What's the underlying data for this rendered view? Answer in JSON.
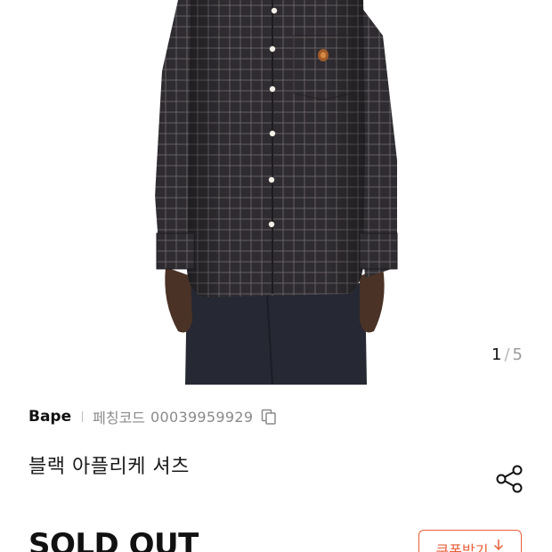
{
  "gallery": {
    "current": "1",
    "separator": "/",
    "total": "5"
  },
  "product": {
    "brand": "Bape",
    "code_label": "페칭코드",
    "code_value": "00039959929",
    "title": "블랙 아플리케 셔츠",
    "status": "SOLD OUT"
  },
  "actions": {
    "coupon_label": "쿠폰받기",
    "coupon_icon": "download-arrow-icon",
    "share_icon": "share-icon",
    "copy_icon": "copy-icon"
  },
  "colors": {
    "accent": "#e8603c",
    "text": "#111111",
    "muted": "#8a8a8a"
  }
}
